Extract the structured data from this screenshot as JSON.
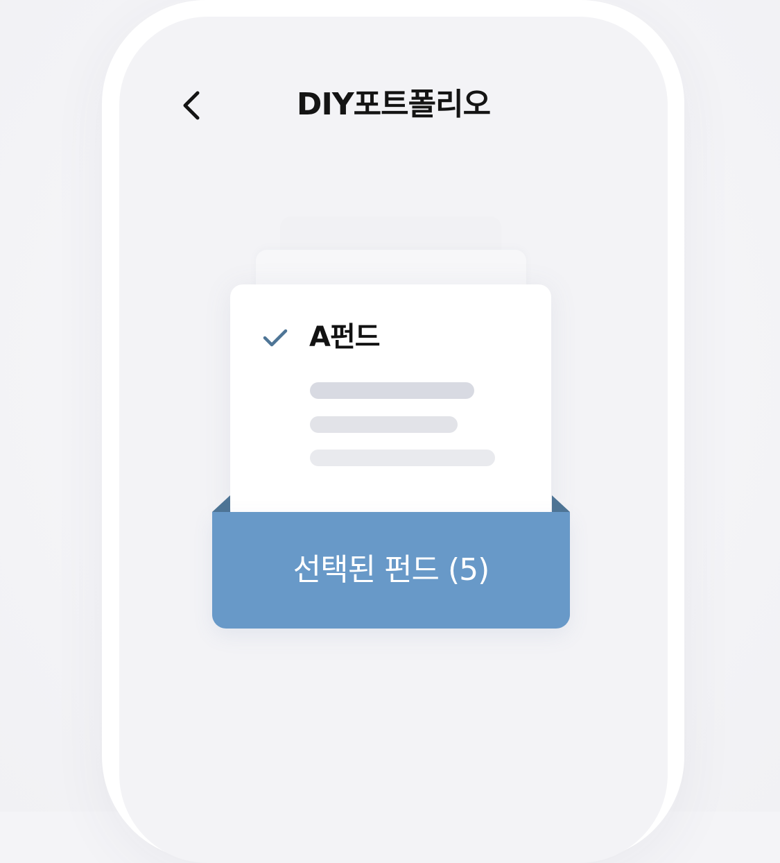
{
  "header": {
    "title": "DIY포트폴리오",
    "back_icon": "chevron-left-icon"
  },
  "card": {
    "fund_name": "A펀드",
    "check_icon": "check-icon",
    "check_color": "#4e7596"
  },
  "pocket": {
    "label": "선택된 펀드 (5)",
    "color": "#6899c8",
    "flap_color": "#4e7596"
  }
}
